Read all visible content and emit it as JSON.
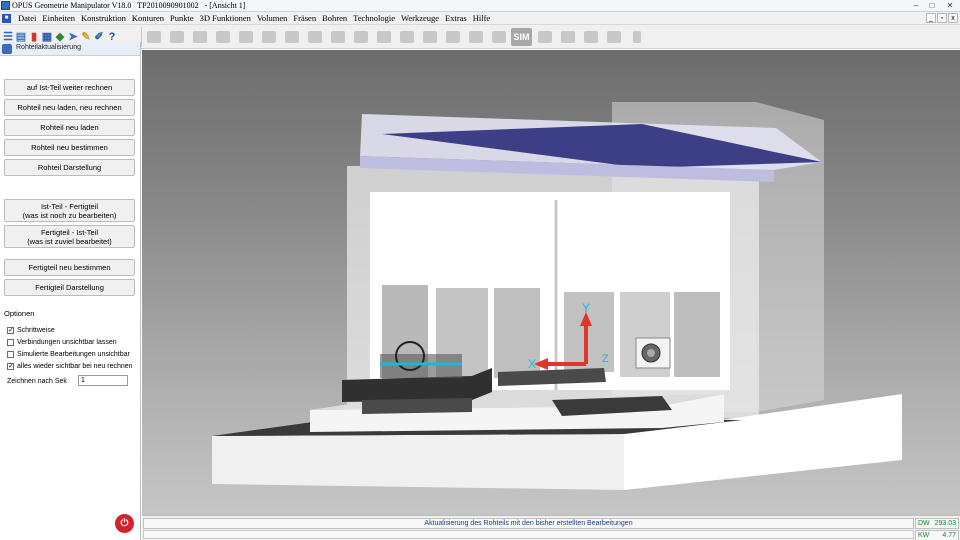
{
  "window": {
    "title": "OPUS Geometrie Manipulator V18.0   TP2010090901002   - [Ansicht 1]",
    "minimize": "–",
    "maximize": "□",
    "close": "✕"
  },
  "menubar": {
    "items": [
      "Datei",
      "Einheiten",
      "Konstruktion",
      "Konturen",
      "Punkte",
      "3D Funktionen",
      "Volumen",
      "Fräsen",
      "Bohren",
      "Technologie",
      "Werkzeuge",
      "Extras",
      "Hilfe"
    ],
    "mdi_minimize": "_",
    "mdi_restore": "▫",
    "mdi_close": "x"
  },
  "toolbar": {
    "sim_label": "SIM"
  },
  "panel": {
    "header": "Rohteilaktualisierung",
    "buttons": [
      "auf Ist-Teil weiter rechnen",
      "Rohteil neu laden, neu rechnen",
      "Rohteil neu laden",
      "Rohteil neu bestimmen",
      "Rohteil Darstellung"
    ],
    "buttons2": [
      {
        "line1": "Ist-Teil - Fertigteil",
        "line2": "(was ist noch zu bearbeiten)"
      },
      {
        "line1": "Fertigteil - Ist-Teil",
        "line2": "(was ist zuviel bearbeitet)"
      }
    ],
    "buttons3": [
      "Fertigteil neu bestimmen",
      "Fertigteil Darstellung"
    ],
    "options_title": "Optionen",
    "options": [
      {
        "label": "Schrittweise",
        "checked": true
      },
      {
        "label": "Verbindungen unsichtbar lassen",
        "checked": false
      },
      {
        "label": "Simulierte Bearbeitungen unsichtbar",
        "checked": false
      },
      {
        "label": "alles wieder sichtbar bei neu rechnen",
        "checked": true
      }
    ],
    "zeichnen_label": "Zeichnen nach Sek",
    "zeichnen_value": "1"
  },
  "viewport": {
    "axis_y": "Y",
    "axis_x": "X",
    "axis_z": "Z",
    "colors": {
      "axis_y": "#e0352b",
      "axis_x": "#e0352b",
      "axis_label": "#19b8e6",
      "roof": "#3d3f86"
    }
  },
  "status": {
    "message": "Aktualisierung des Rohteils mit den bisher erstellten Bearbeitungen",
    "dw_label": "DW",
    "dw_value": "293.03",
    "kw_label": "KW",
    "kw_value": "4.77"
  }
}
